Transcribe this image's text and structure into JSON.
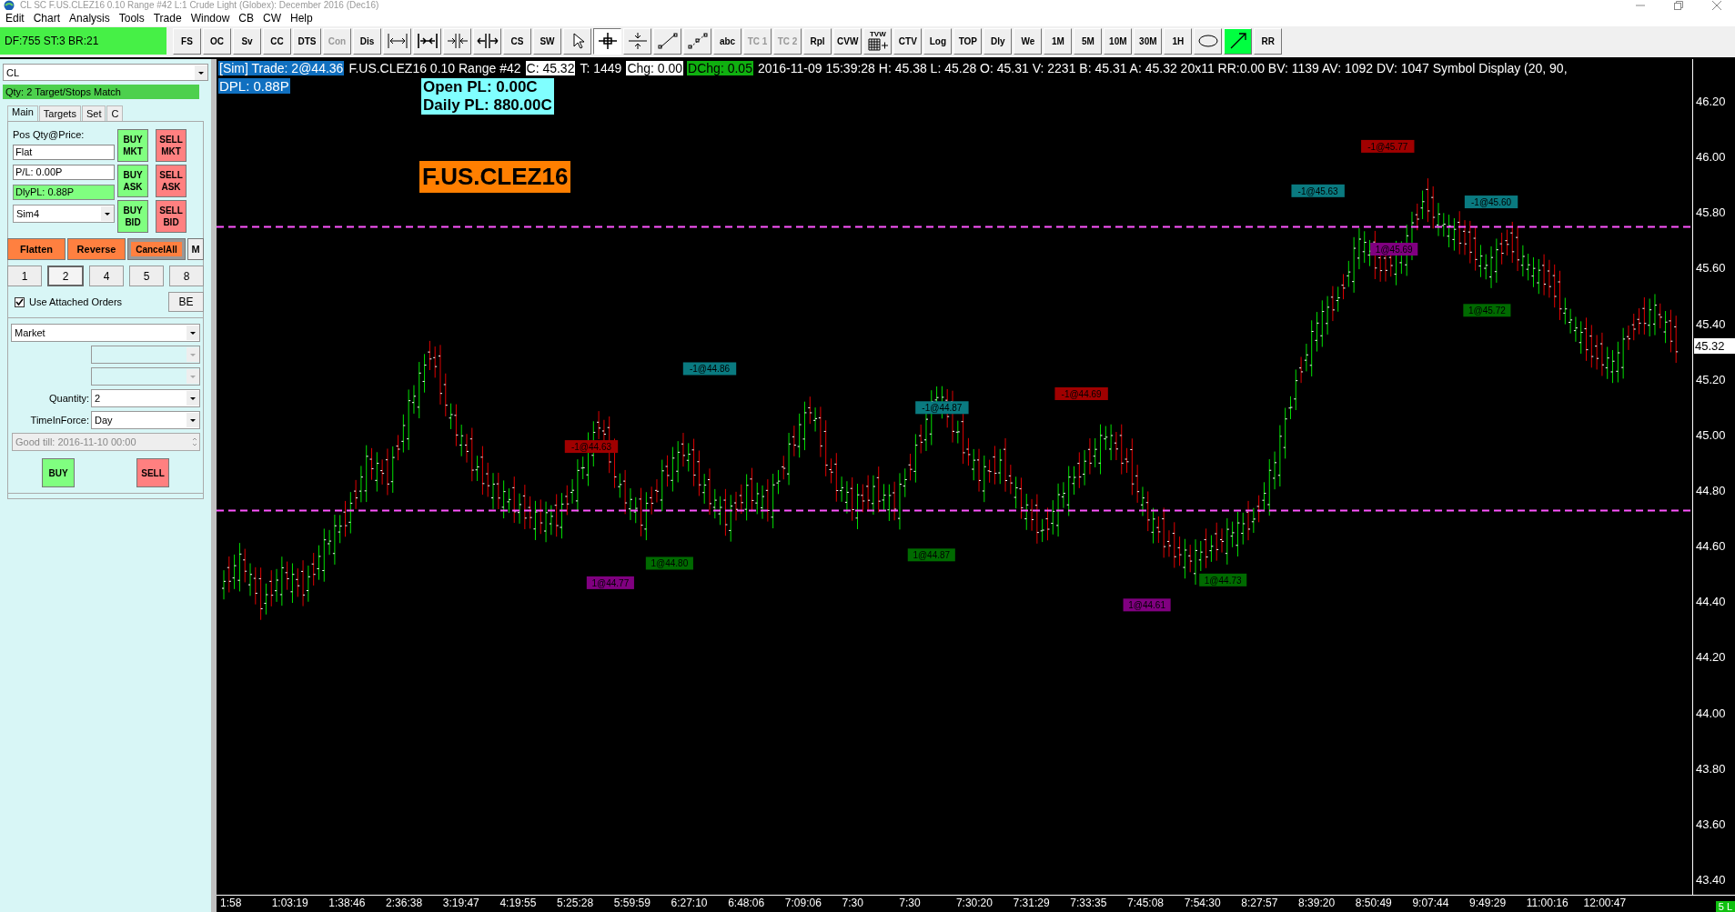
{
  "window": {
    "title": "CL  SC F.US.CLEZ16  0.10 Range  #42  L:1  Crude Light (Globex): December 2016 (Dec16)"
  },
  "menu": [
    "Edit",
    "Chart",
    "Analysis",
    "Tools",
    "Trade",
    "Window",
    "CB",
    "CW",
    "Help"
  ],
  "status": "DF:755  ST:3  BR:21",
  "toolbar": [
    {
      "kind": "text",
      "label": "FS",
      "disabled": false,
      "selected": false
    },
    {
      "kind": "text",
      "label": "OC",
      "disabled": false,
      "selected": false
    },
    {
      "kind": "text",
      "label": "Sv",
      "disabled": false,
      "selected": false
    },
    {
      "kind": "text",
      "label": "CC",
      "disabled": false,
      "selected": false
    },
    {
      "kind": "text",
      "label": "DTS",
      "disabled": false,
      "selected": false
    },
    {
      "kind": "text",
      "label": "Con",
      "disabled": true,
      "selected": false
    },
    {
      "kind": "text",
      "label": "Dis",
      "disabled": false,
      "selected": false
    },
    {
      "kind": "icon",
      "selected": false
    },
    {
      "kind": "icon",
      "selected": false
    },
    {
      "kind": "icon",
      "selected": false
    },
    {
      "kind": "icon",
      "selected": false
    },
    {
      "kind": "text",
      "label": "CS",
      "disabled": false,
      "selected": false
    },
    {
      "kind": "text",
      "label": "SW",
      "disabled": false,
      "selected": false
    },
    {
      "kind": "icon",
      "selected": false
    },
    {
      "kind": "icon",
      "selected": true
    },
    {
      "kind": "icon",
      "selected": false
    },
    {
      "kind": "icon",
      "selected": false
    },
    {
      "kind": "icon",
      "selected": false
    },
    {
      "kind": "text",
      "label": "abc",
      "disabled": false,
      "selected": false
    },
    {
      "kind": "text",
      "label": "TC 1",
      "disabled": true,
      "selected": false
    },
    {
      "kind": "text",
      "label": "TC 2",
      "disabled": true,
      "selected": false
    },
    {
      "kind": "text",
      "label": "Rpl",
      "disabled": false,
      "selected": false
    },
    {
      "kind": "text",
      "label": "CVW",
      "disabled": false,
      "selected": false
    },
    {
      "kind": "grid",
      "label": "TVW",
      "selected": false
    },
    {
      "kind": "text",
      "label": "CTV",
      "disabled": false,
      "selected": false
    },
    {
      "kind": "text",
      "label": "Log",
      "disabled": false,
      "selected": false
    },
    {
      "kind": "text",
      "label": "TOP",
      "disabled": false,
      "selected": false
    },
    {
      "kind": "text",
      "label": "Dly",
      "disabled": false,
      "selected": false
    },
    {
      "kind": "text",
      "label": "We",
      "disabled": false,
      "selected": false
    },
    {
      "kind": "text",
      "label": "1M",
      "disabled": false,
      "selected": false
    },
    {
      "kind": "text",
      "label": "5M",
      "disabled": false,
      "selected": false
    },
    {
      "kind": "text",
      "label": "10M",
      "disabled": false,
      "selected": false
    },
    {
      "kind": "text",
      "label": "30M",
      "disabled": false,
      "selected": false
    },
    {
      "kind": "text",
      "label": "1H",
      "disabled": false,
      "selected": false
    },
    {
      "kind": "icon",
      "selected": false
    },
    {
      "kind": "toggle",
      "on": true,
      "selected": false
    },
    {
      "kind": "text",
      "label": "RR",
      "disabled": false,
      "selected": false
    }
  ],
  "trade_panel": {
    "symbol": "CL",
    "match_status": "Qty: 2 Target/Stops Match",
    "tabs": [
      {
        "label": "Main",
        "selected": true
      },
      {
        "label": "Targets",
        "selected": false
      },
      {
        "label": "Set",
        "selected": false
      },
      {
        "label": "C",
        "selected": false
      }
    ],
    "pos_label": "Pos Qty@Price:",
    "position": "Flat",
    "pl": "P/L: 0.00P",
    "daily_pl": "DlyPL: 0.88P",
    "account": "Sim4",
    "order_buttons": [
      {
        "kind": "buy",
        "label": "BUY MKT"
      },
      {
        "kind": "sell",
        "label": "SELL MKT"
      },
      {
        "kind": "buy",
        "label": "BUY ASK"
      },
      {
        "kind": "sell",
        "label": "SELL ASK"
      },
      {
        "kind": "buy",
        "label": "BUY BID"
      },
      {
        "kind": "sell",
        "label": "SELL BID"
      }
    ],
    "action_buttons": [
      "Flatten",
      "Reverse",
      "CancelAll"
    ],
    "m_button": "M",
    "quantities": [
      {
        "label": "1",
        "selected": false
      },
      {
        "label": "2",
        "selected": true
      },
      {
        "label": "4",
        "selected": false
      },
      {
        "label": "5",
        "selected": false
      },
      {
        "label": "8",
        "selected": false
      }
    ],
    "attached_orders": {
      "label": "Use Attached Orders",
      "checked": true
    },
    "be_button": "BE",
    "order_type": "Market",
    "quantity_label": "Quantity:",
    "quantity": "2",
    "tif_label": "TimeInForce:",
    "tif": "Day",
    "good_till": "Good till: 2016-11-10 00:00",
    "buy": "BUY",
    "sell": "SELL"
  },
  "chart": {
    "info": [
      {
        "kind": "sim",
        "text": "[Sim]  Trade: 2@44.36"
      },
      {
        "kind": "plain",
        "text": "F.US.CLEZ16  0.10 Range  #42"
      },
      {
        "kind": "white",
        "text": "C: 45.32"
      },
      {
        "kind": "plain",
        "text": "T: 1449"
      },
      {
        "kind": "white",
        "text": "Chg: 0.00"
      },
      {
        "kind": "green",
        "text": "DChg: 0.05"
      },
      {
        "kind": "plain",
        "text": "2016-11-09 15:39:28 H: 45.38 L: 45.28 O: 45.31 V: 2231 B: 45.31 A: 45.32 20x11 RR:0.00 BV: 1139 AV: 1092 DV: 1047  Symbol Display   (20, 90,"
      }
    ],
    "dpl": "DPL: 0.88P",
    "open_pl": "Open PL: 0.00C",
    "daily_pl": "Daily PL: 880.00C",
    "symbol": "F.US.CLEZ16",
    "last_price": "45.32",
    "corner_badge": "5 L",
    "price_axis": [
      "46.20",
      "46.00",
      "45.80",
      "45.60",
      "45.40",
      "45.20",
      "45.00",
      "44.80",
      "44.60",
      "44.40",
      "44.20",
      "44.00",
      "43.80",
      "43.60",
      "43.40"
    ],
    "time_axis": [
      "1:58",
      "1:03:19",
      "1:38:46",
      "2:36:38",
      "3:19:47",
      "4:19:55",
      "5:25:28",
      "5:59:59",
      "6:27:10",
      "6:48:06",
      "7:09:06",
      "7:30",
      "7:30",
      "7:30:20",
      "7:31:29",
      "7:33:35",
      "7:45:08",
      "7:54:30",
      "8:27:57",
      "8:39:20",
      "8:50:49",
      "9:07:44",
      "9:49:29",
      "11:00:16",
      "12:00:47"
    ],
    "trade_markers": [
      {
        "text": "-1@44.86",
        "color": "#0a7a80"
      },
      {
        "text": "-1@44.63",
        "color": "#a00000"
      },
      {
        "text": "1@44.77",
        "color": "#800080"
      },
      {
        "text": "1@44.80",
        "color": "#006a00"
      },
      {
        "text": "-1@44.87",
        "color": "#0a7a80"
      },
      {
        "text": "1@44.87",
        "color": "#006a00"
      },
      {
        "text": "-1@44.69",
        "color": "#a00000"
      },
      {
        "text": "1@44.61",
        "color": "#800080"
      },
      {
        "text": "1@44.73",
        "color": "#006a00"
      },
      {
        "text": "-1@45.63",
        "color": "#0a7a80"
      },
      {
        "text": "-1@45.77",
        "color": "#a00000"
      },
      {
        "text": "1@45.69",
        "color": "#800080"
      },
      {
        "text": "-1@45.60",
        "color": "#0a7a80"
      },
      {
        "text": "1@45.72",
        "color": "#006a00"
      }
    ]
  }
}
